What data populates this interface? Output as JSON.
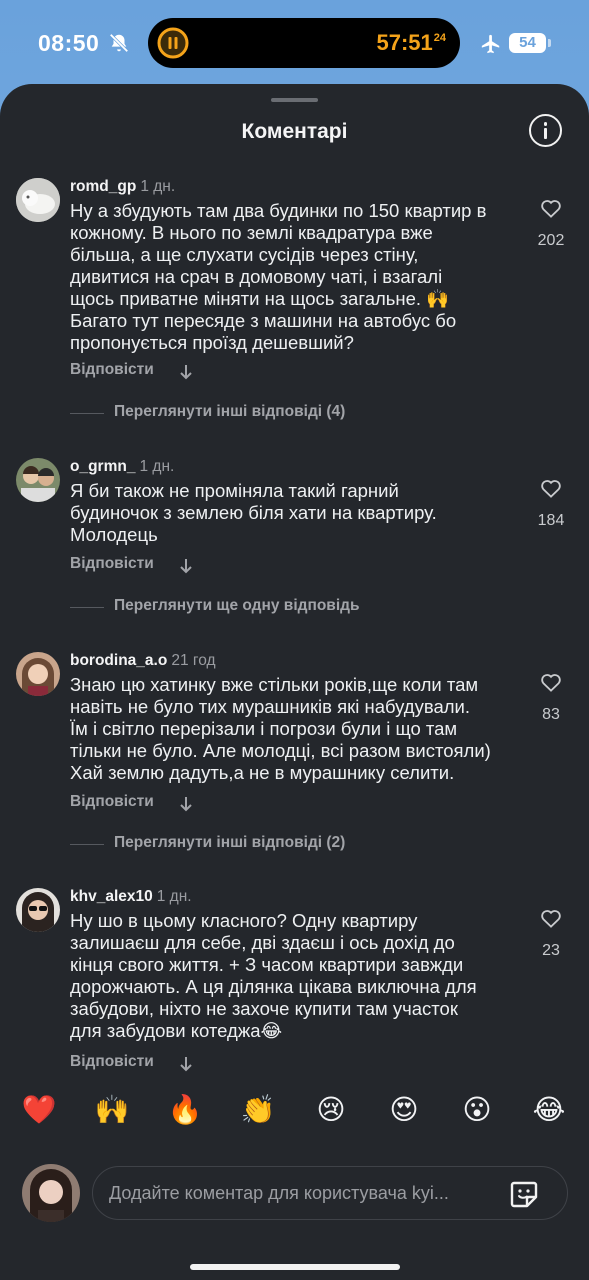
{
  "status_bar": {
    "time": "08:50",
    "timer": "57:51",
    "timer_fraction": "24",
    "battery": "54",
    "timer_color": "#f4a31a"
  },
  "sheet": {
    "title": "Коментарі"
  },
  "comments": [
    {
      "user": "romd_gp",
      "time": "1 дн.",
      "text": "Ну а збудують там два будинки по 150 квартир в\nкожному. В нього по землі квадратура вже\nбільша, а ще слухати сусідів через стіну,\nдивитися на срач в домовому чаті, і взагалі\nщось приватне міняти на щось загальне. 🙌\nБагато тут пересяде з машини на автобус бо\nпропонується проїзд дешевший?",
      "likes": "202",
      "reply": "Відповісти",
      "more": "Переглянути інші відповіді (4)"
    },
    {
      "user": "o_grmn_",
      "time": "1 дн.",
      "text": "Я би також не проміняла такий гарний\nбудиночок з землею біля хати на квартиру.\nМолодець",
      "likes": "184",
      "reply": "Відповісти",
      "more": "Переглянути ще одну відповідь"
    },
    {
      "user": "borodina_a.o",
      "time": "21 год",
      "text": "Знаю цю хатинку вже стільки років,ще коли там\nнавіть не було тих мурашників які набудували.\nЇм і світло перерізали і погрози були і що там\nтільки не було. Але молодці, всі разом вистояли)\nХай землю дадуть,а не в мурашнику селити.",
      "likes": "83",
      "reply": "Відповісти",
      "more": "Переглянути інші відповіді (2)"
    },
    {
      "user": "khv_alex10",
      "time": "1 дн.",
      "text": "Ну шо в цьому класного? Одну квартиру\nзалишаєш для себе, дві здаєш і ось дохід до\nкінця свого життя. + З часом квартири завжди\nдорожчають. А ця ділянка цікава виключна для\nзабудови, ніхто не захоче купити там участок\nдля забудови котеджа😂",
      "likes": "23",
      "reply": "Відповісти"
    }
  ],
  "emojis": [
    "❤️",
    "🙌",
    "🔥",
    "👏",
    "😢",
    "😍",
    "😮",
    "😂"
  ],
  "input": {
    "placeholder": "Додайте коментар для користувача kyi..."
  },
  "icons": {
    "heart": "heart-icon",
    "info": "info-icon",
    "reply_arrow": "arrow-down-icon",
    "sticker": "sticker-icon",
    "plane": "airplane-icon",
    "bell": "bell-slash-icon"
  }
}
